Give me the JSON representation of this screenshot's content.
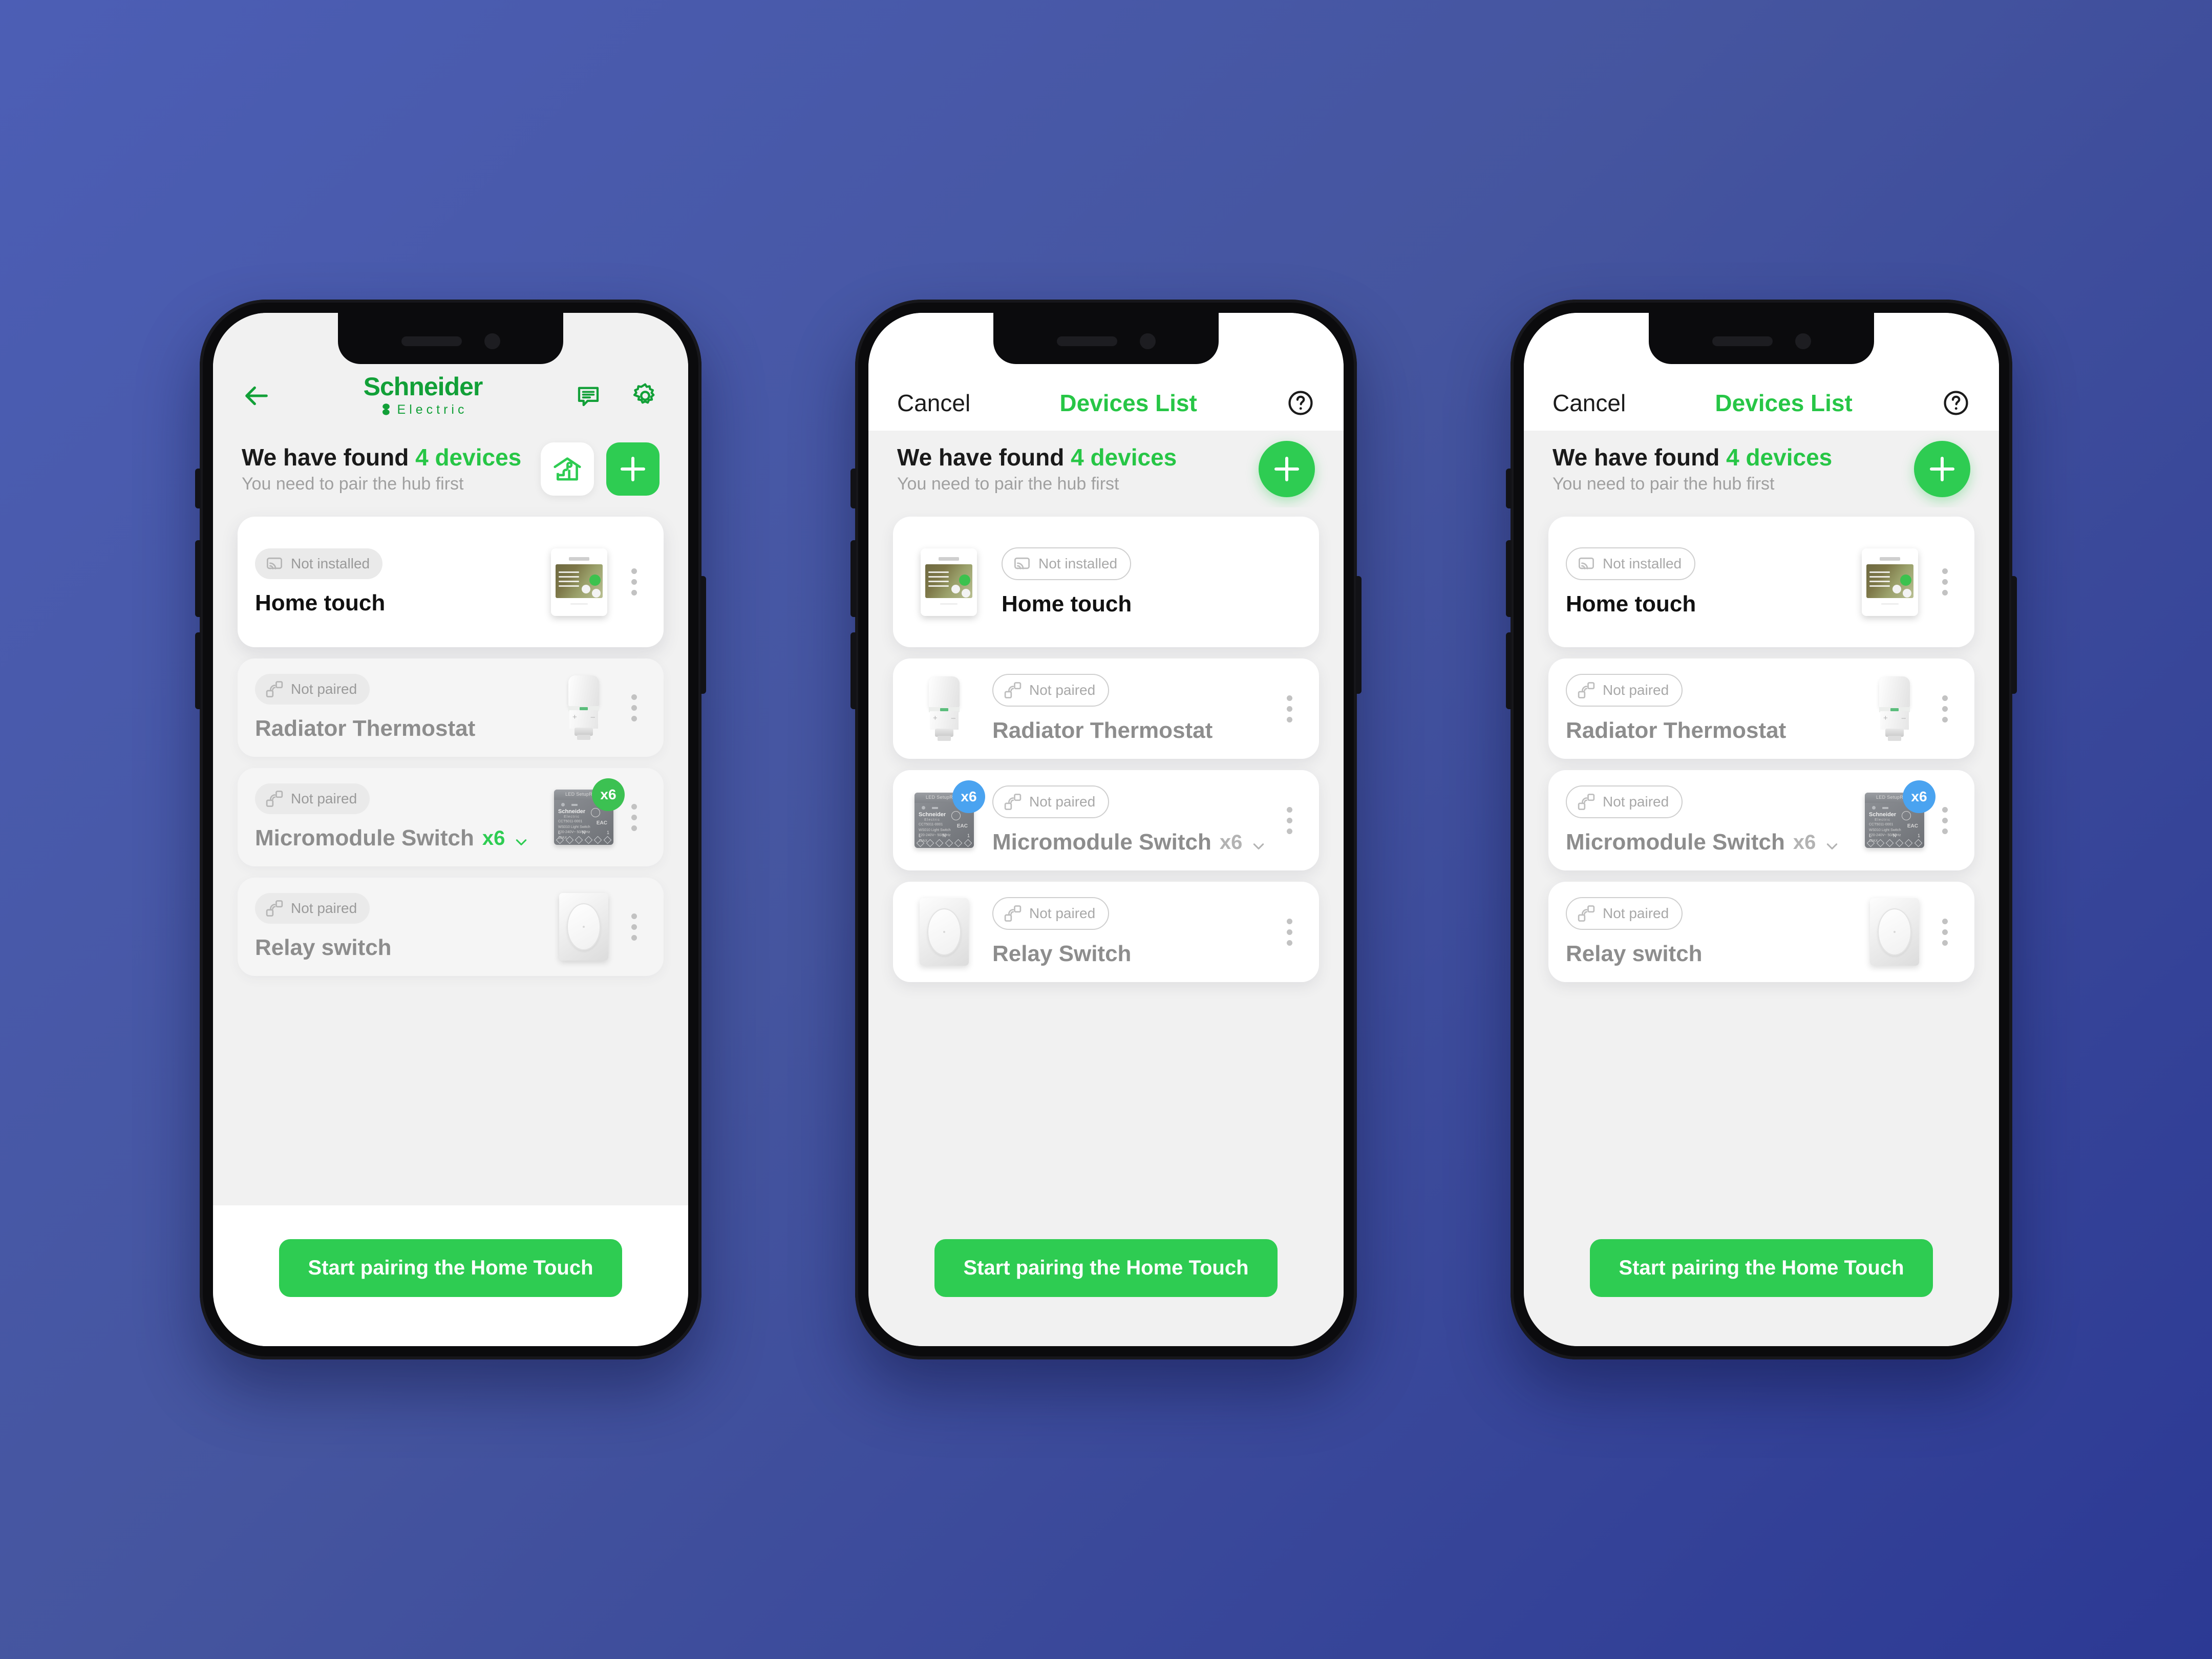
{
  "theme": {
    "bg_gradient_from": "#4c5eb5",
    "bg_gradient_to": "#2c3994",
    "brand_green": "#12a038",
    "accent_green": "#2ecc52",
    "badge_green": "#3cc152",
    "badge_blue": "#4aa3f0",
    "muted_text": "#9a9a9a"
  },
  "phones": [
    {
      "id": "phone-1",
      "nav": {
        "style": "brand",
        "back_icon": "arrow-left-icon",
        "brand_line1": "Schneider",
        "brand_line2": "Electric",
        "chat_icon": "chat-bubble-icon",
        "settings_icon": "gear-icon"
      },
      "headline": {
        "main_prefix": "We have found ",
        "main_accent": "4 devices",
        "sub": "You need to pair the hub first",
        "hub_button_icon": "home-hub-icon",
        "add_button_icon": "plus-icon",
        "add_button_shape": "square"
      },
      "devices": [
        {
          "name": "Home touch",
          "status": "Not installed",
          "status_icon": "cast-screen-icon",
          "pill_style": "solid",
          "card_style": "active",
          "name_style": "dark",
          "media": "hometouch",
          "media_side": "right",
          "quantity": null,
          "badge": null,
          "kebab_icon": "kebab-menu-icon"
        },
        {
          "name": "Radiator Thermostat",
          "status": "Not paired",
          "status_icon": "pairing-signal-icon",
          "pill_style": "solid",
          "card_style": "dim",
          "name_style": "muted",
          "media": "thermostat",
          "media_side": "right",
          "quantity": null,
          "badge": null,
          "kebab_icon": "kebab-menu-icon"
        },
        {
          "name": "Micromodule Switch",
          "status": "Not paired",
          "status_icon": "pairing-signal-icon",
          "pill_style": "solid",
          "card_style": "dim",
          "name_style": "muted",
          "media": "micromodule",
          "media_side": "right",
          "quantity": "x6",
          "quantity_color": "green",
          "chevron_icon": "chevron-down-icon",
          "badge": "x6",
          "badge_color": "#3cc152",
          "kebab_icon": "kebab-menu-icon"
        },
        {
          "name": "Relay switch",
          "status": "Not paired",
          "status_icon": "pairing-signal-icon",
          "pill_style": "solid",
          "card_style": "dim",
          "name_style": "muted",
          "media": "relay",
          "media_side": "right",
          "quantity": null,
          "badge": null,
          "kebab_icon": "kebab-menu-icon"
        }
      ],
      "cta": "Start pairing the Home Touch"
    },
    {
      "id": "phone-2",
      "nav": {
        "style": "modal",
        "cancel": "Cancel",
        "title": "Devices List",
        "help_icon": "help-circle-icon"
      },
      "headline": {
        "main_prefix": "We have found ",
        "main_accent": "4 devices",
        "sub": "You need to pair the hub first",
        "add_button_icon": "plus-icon",
        "add_button_shape": "circle"
      },
      "devices": [
        {
          "name": "Home touch",
          "status": "Not installed",
          "status_icon": "cast-screen-icon",
          "pill_style": "outline",
          "card_style": "plain",
          "name_style": "dark",
          "media": "hometouch",
          "media_side": "left",
          "quantity": null,
          "badge": null,
          "kebab_icon": null
        },
        {
          "name": "Radiator Thermostat",
          "status": "Not paired",
          "status_icon": "pairing-signal-icon",
          "pill_style": "outline",
          "card_style": "plain",
          "name_style": "muted",
          "media": "thermostat",
          "media_side": "left",
          "quantity": null,
          "badge": null,
          "kebab_icon": "kebab-menu-icon"
        },
        {
          "name": "Micromodule Switch",
          "status": "Not paired",
          "status_icon": "pairing-signal-icon",
          "pill_style": "outline",
          "card_style": "plain",
          "name_style": "muted",
          "media": "micromodule",
          "media_side": "left",
          "quantity": "x6",
          "quantity_color": "grey",
          "chevron_icon": "chevron-down-icon",
          "badge": "x6",
          "badge_color": "#4aa3f0",
          "kebab_icon": "kebab-menu-icon"
        },
        {
          "name": "Relay Switch",
          "status": "Not paired",
          "status_icon": "pairing-signal-icon",
          "pill_style": "outline",
          "card_style": "plain",
          "name_style": "muted",
          "media": "relay",
          "media_side": "left",
          "quantity": null,
          "badge": null,
          "kebab_icon": "kebab-menu-icon"
        }
      ],
      "cta": "Start pairing the Home Touch"
    },
    {
      "id": "phone-3",
      "nav": {
        "style": "modal",
        "cancel": "Cancel",
        "title": "Devices List",
        "help_icon": "help-circle-icon"
      },
      "headline": {
        "main_prefix": "We have found ",
        "main_accent": "4 devices",
        "sub": "You need to pair the hub first",
        "add_button_icon": "plus-icon",
        "add_button_shape": "circle"
      },
      "devices": [
        {
          "name": "Home touch",
          "status": "Not installed",
          "status_icon": "cast-screen-icon",
          "pill_style": "outline",
          "card_style": "plain",
          "name_style": "dark",
          "media": "hometouch",
          "media_side": "right",
          "quantity": null,
          "badge": null,
          "kebab_icon": "kebab-menu-icon"
        },
        {
          "name": "Radiator Thermostat",
          "status": "Not paired",
          "status_icon": "pairing-signal-icon",
          "pill_style": "outline",
          "card_style": "plain",
          "name_style": "muted",
          "media": "thermostat",
          "media_side": "right",
          "quantity": null,
          "badge": null,
          "kebab_icon": "kebab-menu-icon"
        },
        {
          "name": "Micromodule Switch",
          "status": "Not paired",
          "status_icon": "pairing-signal-icon",
          "pill_style": "outline",
          "card_style": "plain",
          "name_style": "muted",
          "media": "micromodule",
          "media_side": "right",
          "quantity": "x6",
          "quantity_color": "grey",
          "chevron_icon": "chevron-down-icon",
          "badge": "x6",
          "badge_color": "#4aa3f0",
          "kebab_icon": "kebab-menu-icon"
        },
        {
          "name": "Relay switch",
          "status": "Not paired",
          "status_icon": "pairing-signal-icon",
          "pill_style": "outline",
          "card_style": "plain",
          "name_style": "muted",
          "media": "relay",
          "media_side": "right",
          "quantity": null,
          "badge": null,
          "kebab_icon": "kebab-menu-icon"
        }
      ],
      "cta": "Start pairing the Home Touch"
    }
  ]
}
